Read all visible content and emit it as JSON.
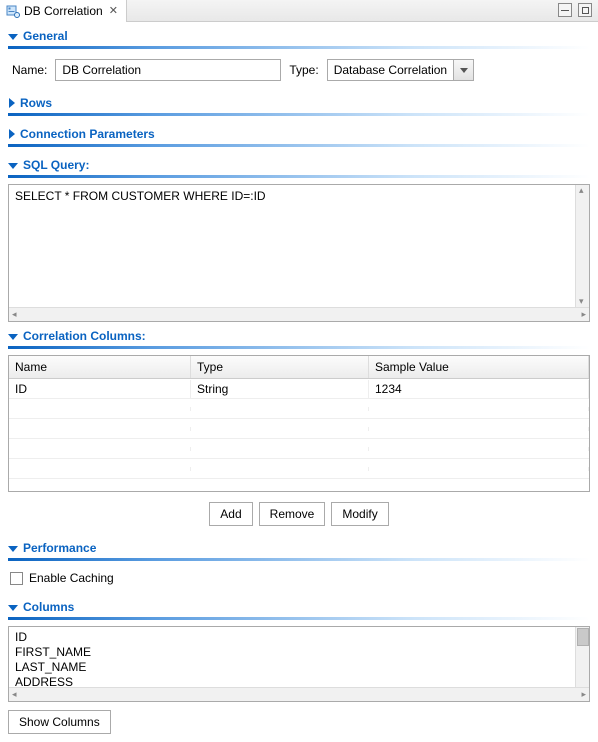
{
  "tab": {
    "title": "DB Correlation"
  },
  "sections": {
    "general": "General",
    "rows": "Rows",
    "connection": "Connection Parameters",
    "sql": "SQL Query:",
    "corr": "Correlation Columns:",
    "perf": "Performance",
    "cols": "Columns"
  },
  "general": {
    "name_label": "Name:",
    "name_value": "DB Correlation",
    "type_label": "Type:",
    "type_value": "Database Correlation"
  },
  "sql": {
    "text": "SELECT * FROM CUSTOMER WHERE ID=:ID"
  },
  "corr_table": {
    "headers": {
      "name": "Name",
      "type": "Type",
      "sample": "Sample Value"
    },
    "rows": [
      {
        "name": "ID",
        "type": "String",
        "sample": "1234"
      }
    ]
  },
  "buttons": {
    "add": "Add",
    "remove": "Remove",
    "modify": "Modify",
    "show_columns": "Show Columns"
  },
  "perf": {
    "enable_caching": "Enable Caching"
  },
  "columns_list": [
    "ID",
    "FIRST_NAME",
    "LAST_NAME",
    "ADDRESS"
  ]
}
